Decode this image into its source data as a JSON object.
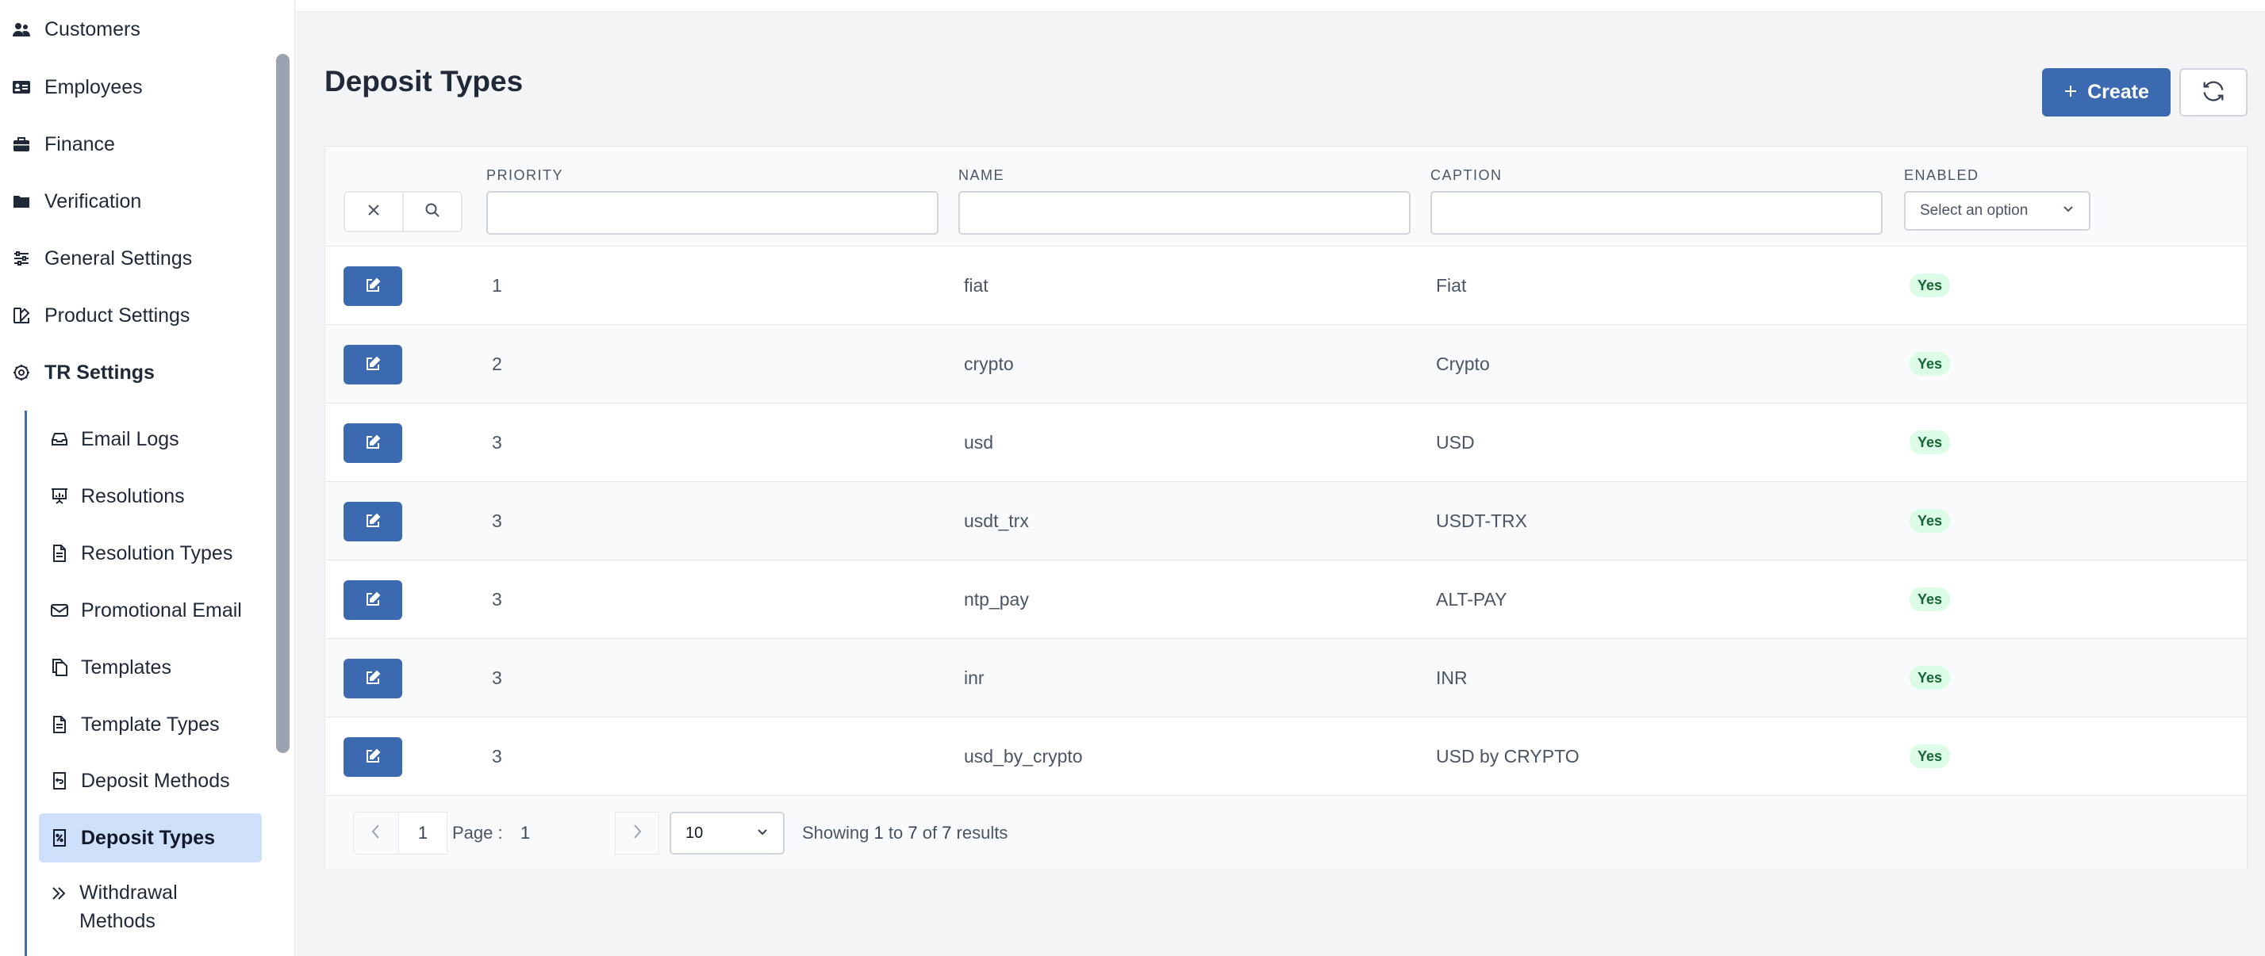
{
  "sidebar": {
    "items": [
      {
        "label": "Customers",
        "icon": "users-icon"
      },
      {
        "label": "Employees",
        "icon": "id-card-icon"
      },
      {
        "label": "Finance",
        "icon": "briefcase-icon"
      },
      {
        "label": "Verification",
        "icon": "folder-icon"
      },
      {
        "label": "General Settings",
        "icon": "sliders-icon"
      },
      {
        "label": "Product Settings",
        "icon": "product-icon"
      },
      {
        "label": "TR Settings",
        "icon": "gear-icon"
      }
    ],
    "sub_items": [
      {
        "label": "Email Logs",
        "icon": "inbox-icon"
      },
      {
        "label": "Resolutions",
        "icon": "presentation-icon"
      },
      {
        "label": "Resolution Types",
        "icon": "document-icon"
      },
      {
        "label": "Promotional Email",
        "icon": "envelope-icon"
      },
      {
        "label": "Templates",
        "icon": "copy-icon"
      },
      {
        "label": "Template Types",
        "icon": "document-icon"
      },
      {
        "label": "Deposit Methods",
        "icon": "receipt-icon"
      },
      {
        "label": "Deposit Types",
        "icon": "receipt-percent-icon"
      },
      {
        "label": "Withdrawal Methods",
        "icon": "double-chevron-icon"
      }
    ]
  },
  "header": {
    "title": "Deposit Types",
    "create_label": "Create"
  },
  "table": {
    "columns": {
      "priority": "PRIORITY",
      "name": "NAME",
      "caption": "CAPTION",
      "enabled": "ENABLED"
    },
    "enabled_placeholder": "Select an option",
    "rows": [
      {
        "priority": "1",
        "name": "fiat",
        "caption": "Fiat",
        "enabled": "Yes"
      },
      {
        "priority": "2",
        "name": "crypto",
        "caption": "Crypto",
        "enabled": "Yes"
      },
      {
        "priority": "3",
        "name": "usd",
        "caption": "USD",
        "enabled": "Yes"
      },
      {
        "priority": "3",
        "name": "usdt_trx",
        "caption": "USDT-TRX",
        "enabled": "Yes"
      },
      {
        "priority": "3",
        "name": "ntp_pay",
        "caption": "ALT-PAY",
        "enabled": "Yes"
      },
      {
        "priority": "3",
        "name": "inr",
        "caption": "INR",
        "enabled": "Yes"
      },
      {
        "priority": "3",
        "name": "usd_by_crypto",
        "caption": "USD by CRYPTO",
        "enabled": "Yes"
      }
    ]
  },
  "pagination": {
    "current_page_button": "1",
    "page_label": "Page :",
    "page_value": "1",
    "page_size": "10",
    "info_prefix": "Showing ",
    "from": "1",
    "to_word": " to ",
    "to": "7",
    "of_word": " of ",
    "total": "7",
    "suffix": " results"
  },
  "colors": {
    "accent": "#3b6ab0",
    "active_bg": "#cfe0fb",
    "badge_bg": "#dcfce7",
    "badge_text": "#166534"
  }
}
